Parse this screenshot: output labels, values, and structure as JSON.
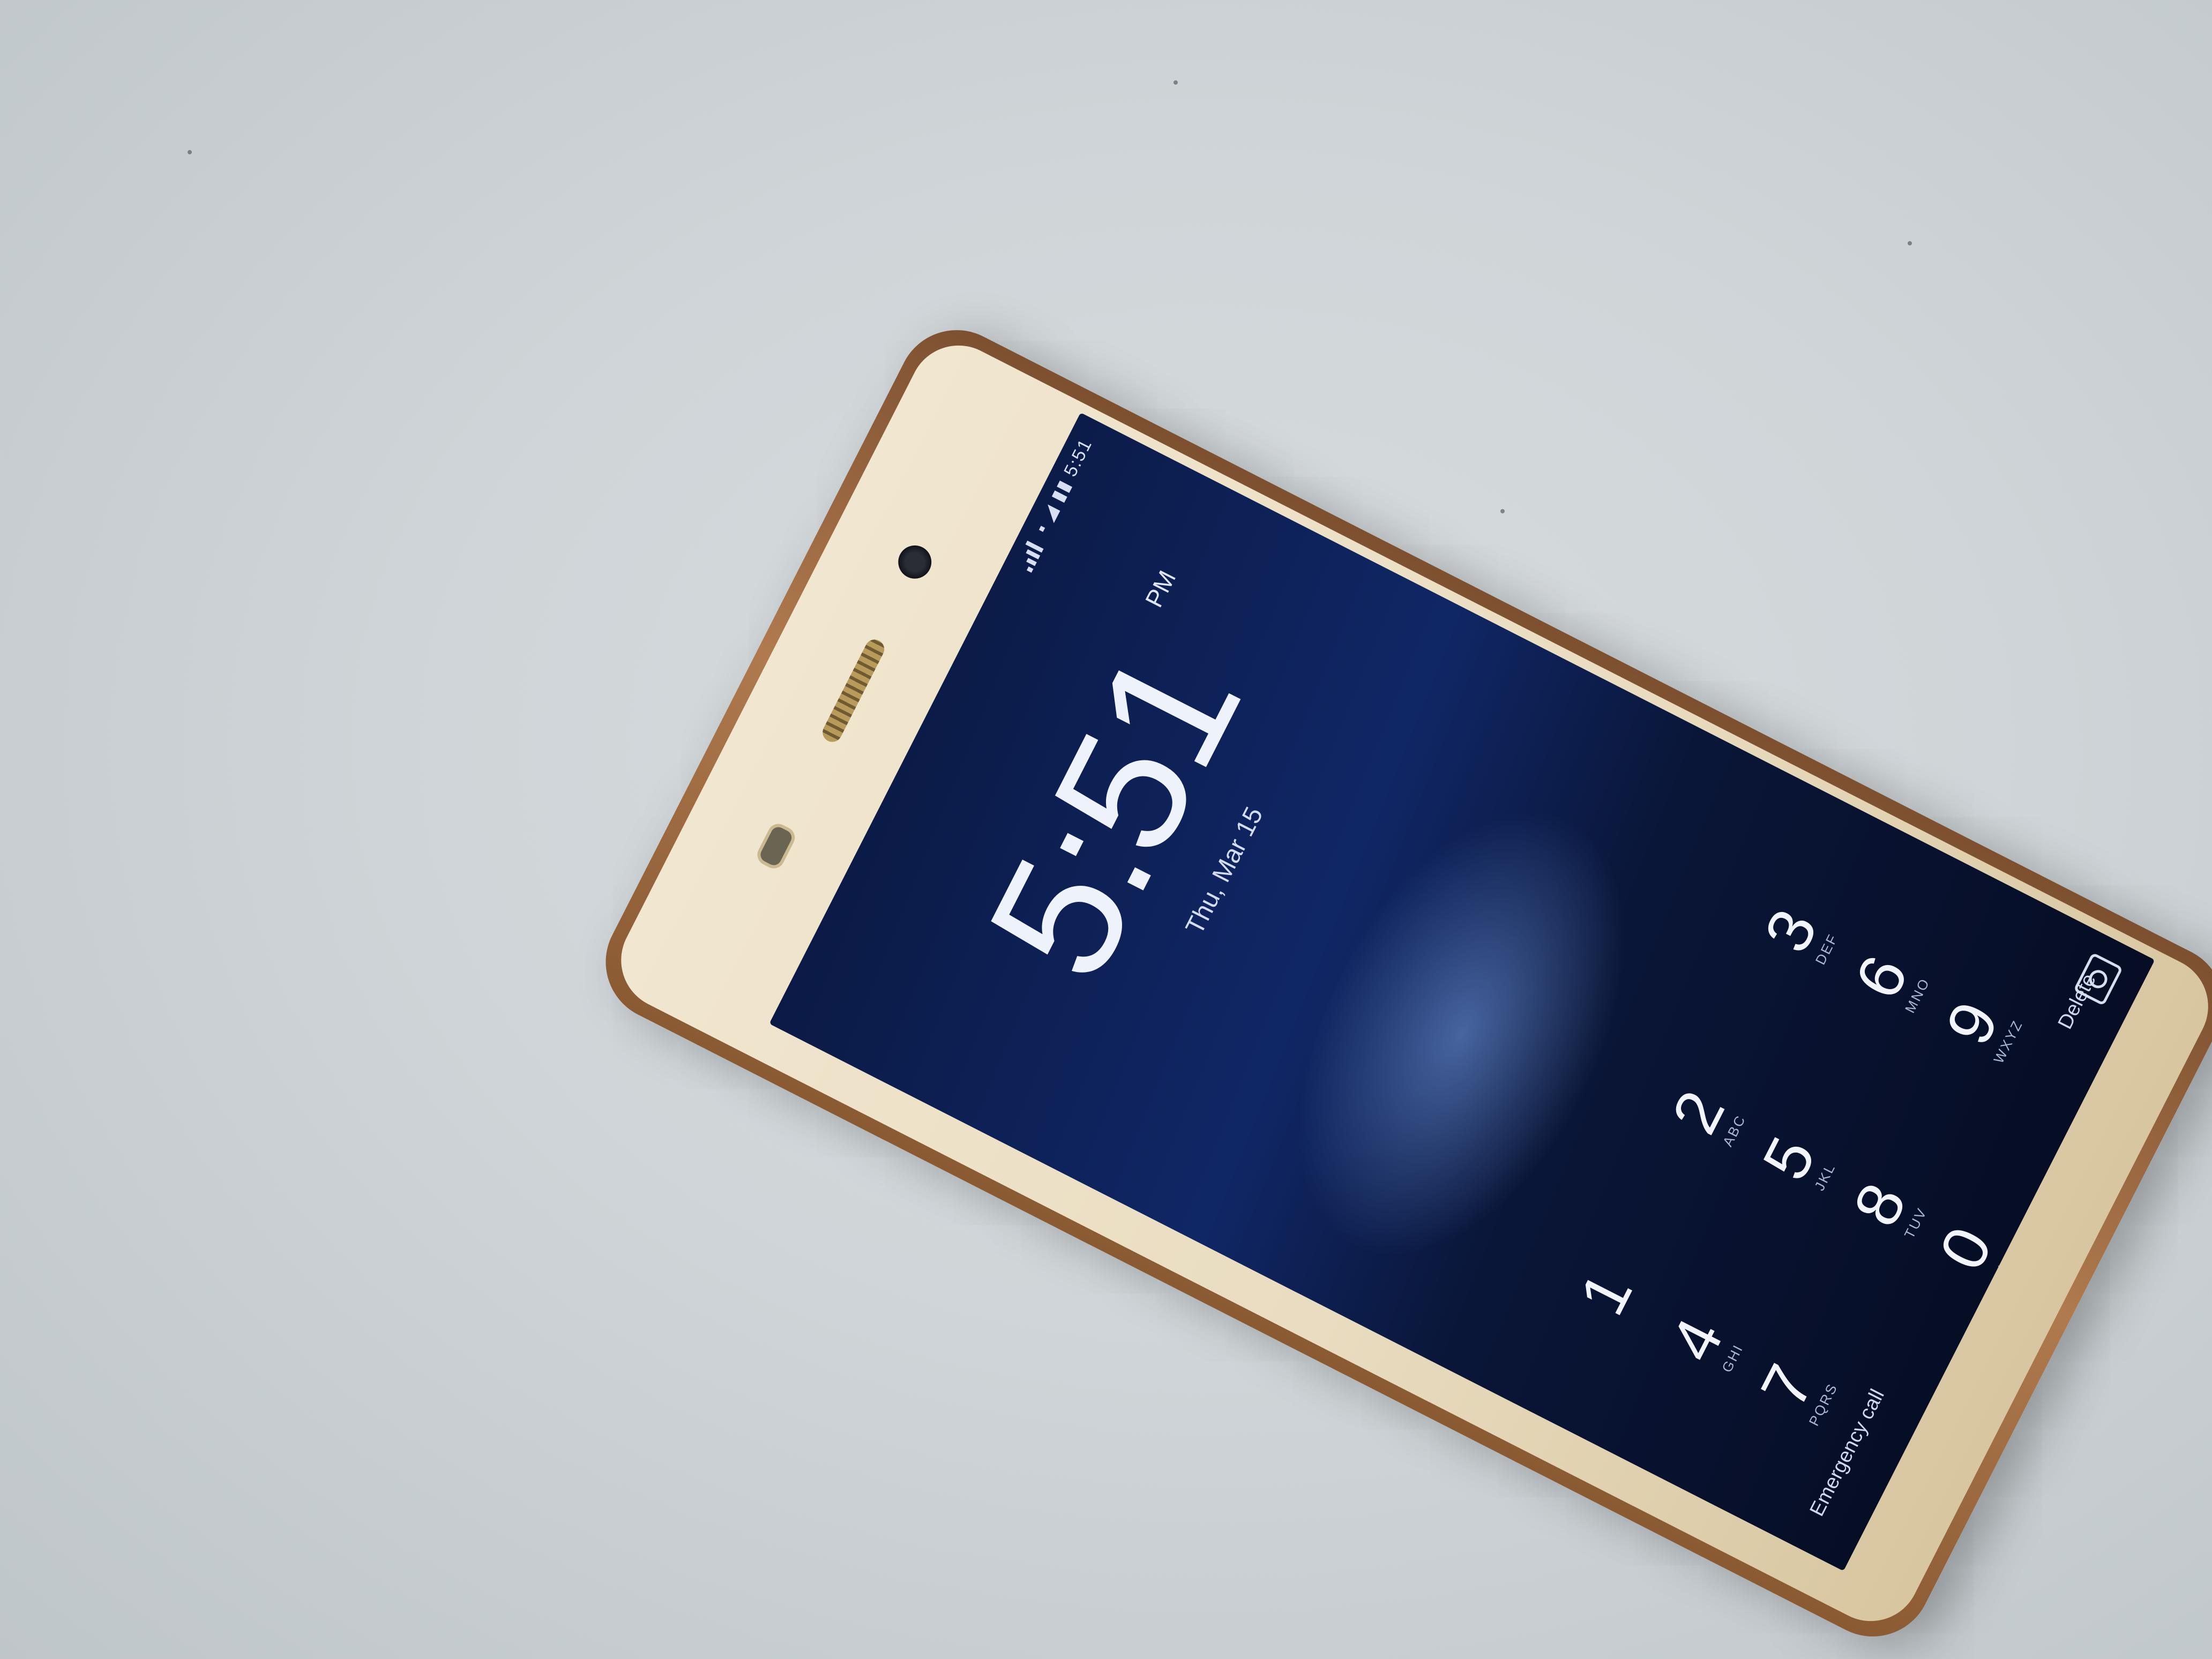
{
  "photo": {
    "surface_color": "#d3d8db",
    "case_color": "#9c6a40",
    "bezel_color": "#eee2c8",
    "screen_color": "#0d1f55"
  },
  "lockscreen": {
    "status": "▪ ◢ ▮▮ 5:51",
    "operator": "",
    "time": "5:51",
    "ampm": "PM",
    "date": "Thu, Mar 15",
    "hint": "",
    "keypad": [
      {
        "digit": "1",
        "letters": ""
      },
      {
        "digit": "2",
        "letters": "ABC"
      },
      {
        "digit": "3",
        "letters": "DEF"
      },
      {
        "digit": "4",
        "letters": "GHI"
      },
      {
        "digit": "5",
        "letters": "JKL"
      },
      {
        "digit": "6",
        "letters": "MNO"
      },
      {
        "digit": "7",
        "letters": "PQRS"
      },
      {
        "digit": "8",
        "letters": "TUV"
      },
      {
        "digit": "9",
        "letters": "WXYZ"
      },
      {
        "digit": "0",
        "letters": "+"
      }
    ],
    "emergency_label": "Emergency call",
    "delete_label": "Delete",
    "camera_icon": "camera-icon"
  }
}
